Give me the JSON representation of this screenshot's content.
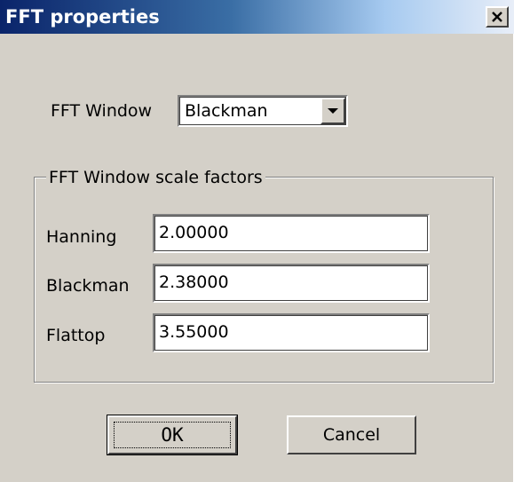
{
  "window": {
    "title": "FFT properties"
  },
  "icons": {
    "close": "close-icon",
    "dropdown": "chevron-down-icon"
  },
  "fft_window": {
    "label": "FFT Window",
    "selected": "Blackman"
  },
  "scale_factors": {
    "group_label": "FFT Window scale factors",
    "fields": [
      {
        "label": "Hanning",
        "value": "2.00000"
      },
      {
        "label": "Blackman",
        "value": "2.38000"
      },
      {
        "label": "Flattop",
        "value": "3.55000"
      }
    ]
  },
  "buttons": {
    "ok_label": "OK",
    "cancel_label": "Cancel"
  },
  "colors": {
    "face": "#d4d0c8",
    "title_active": "#0a246a"
  }
}
